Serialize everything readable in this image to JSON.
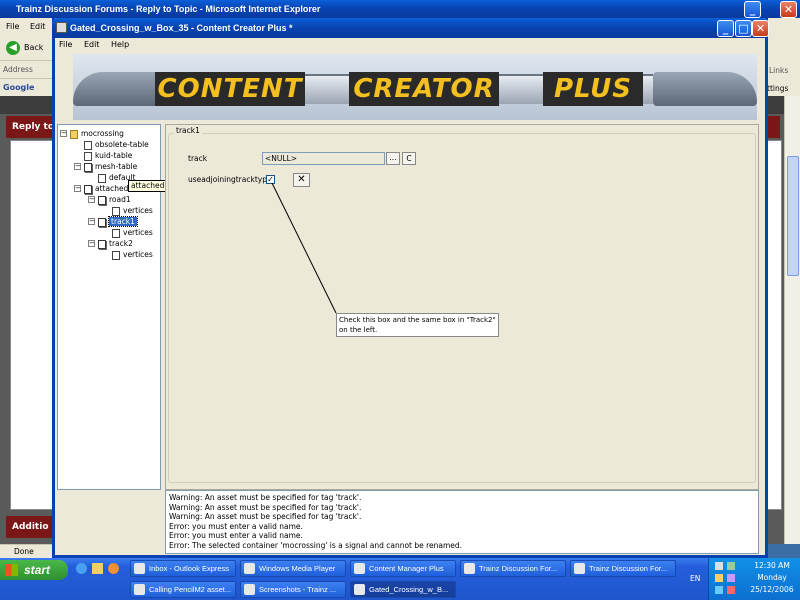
{
  "ie": {
    "title": "Trainz Discussion Forums - Reply to Topic - Microsoft Internet Explorer",
    "menu": [
      "File",
      "Edit"
    ],
    "back_label": "Back",
    "address_label": "Address",
    "google_label": "Google",
    "links_label": "Links",
    "settings_label": "ttings",
    "reply_label": "Reply to",
    "addition_label": "Additio",
    "status_done": "Done"
  },
  "app": {
    "title": "Gated_Crossing_w_Box_35 - Content Creator Plus *",
    "menu": [
      "File",
      "Edit",
      "Help"
    ],
    "banner_words": [
      "CONTENT",
      "CREATOR",
      "PLUS"
    ]
  },
  "tree": {
    "items": [
      {
        "label": "mocrossing"
      },
      {
        "label": "obsolete-table"
      },
      {
        "label": "kuid-table"
      },
      {
        "label": "mesh-table"
      },
      {
        "label": "default"
      },
      {
        "label": "attached"
      },
      {
        "label": "road1"
      },
      {
        "label": "vertices"
      },
      {
        "label": "track1"
      },
      {
        "label": "vertices"
      },
      {
        "label": "track2"
      },
      {
        "label": "vertices"
      }
    ],
    "tooltip": "attached-track-element"
  },
  "panel": {
    "group_title": "track1",
    "track_label": "track",
    "track_value": "<NULL>",
    "browse_label": "...",
    "clear_label": "C",
    "checkbox_label": "useadjoiningtracktype",
    "checkbox_checked": true,
    "annotation": "Check this box and the same box in \"Track2\" on the left."
  },
  "log": {
    "lines": [
      "Warning: An asset must be specified for tag 'track'.",
      "Warning: An asset must be specified for tag 'track'.",
      "Warning: An asset must be specified for tag 'track'.",
      "Error: you must enter a valid name.",
      "Error: you must enter a valid name.",
      "Error: The selected container 'mocrossing' is a signal and cannot be renamed."
    ]
  },
  "taskbar": {
    "start_label": "start",
    "row1": [
      "Inbox - Outlook Express",
      "Windows Media Player",
      "Content Manager Plus",
      "Trainz Discussion For...",
      "Trainz Discussion For..."
    ],
    "row2": [
      "Calling PencilM2 asset...",
      "Screenshots - Trainz ...",
      "Gated_Crossing_w_B..."
    ],
    "lang": "EN",
    "time": "12:30 AM",
    "day": "Monday",
    "date": "25/12/2006"
  },
  "colors": {
    "xp_blue": "#0a47c8",
    "dialog_bg": "#ece9d8",
    "forum_red": "#8b1a1a"
  }
}
